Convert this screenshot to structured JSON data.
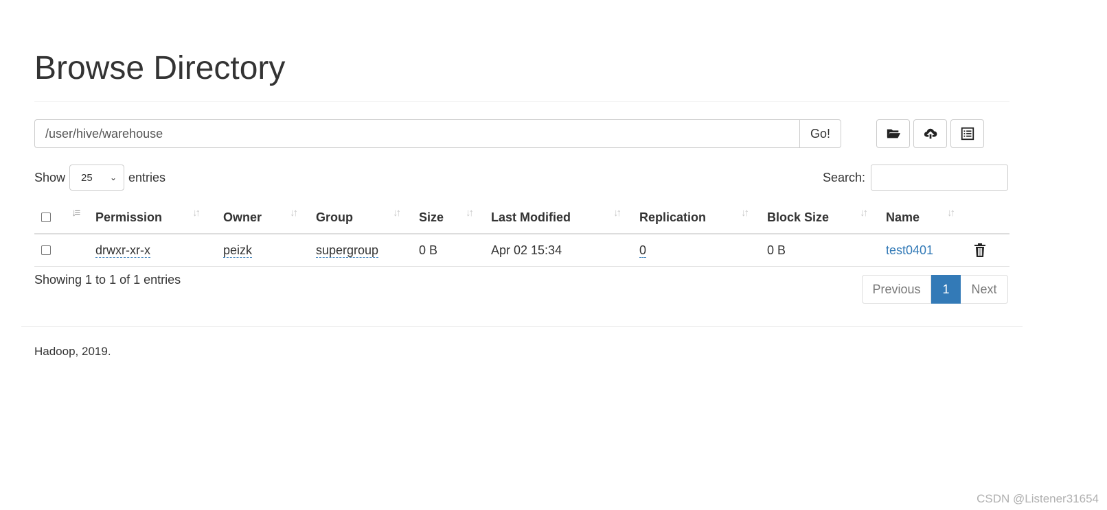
{
  "page": {
    "title": "Browse Directory",
    "path_value": "/user/hive/warehouse",
    "go_label": "Go!"
  },
  "toolbar": {
    "icons": [
      "folder-open-icon",
      "cloud-upload-icon",
      "list-alt-icon"
    ]
  },
  "entries": {
    "show_label": "Show",
    "selected": "25",
    "suffix": "entries"
  },
  "search": {
    "label": "Search:",
    "value": ""
  },
  "table": {
    "headers": {
      "permission": "Permission",
      "owner": "Owner",
      "group": "Group",
      "size": "Size",
      "last_modified": "Last Modified",
      "replication": "Replication",
      "block_size": "Block Size",
      "name": "Name"
    },
    "rows": [
      {
        "permission": "drwxr-xr-x",
        "owner": "peizk",
        "group": "supergroup",
        "size": "0 B",
        "last_modified": "Apr 02 15:34",
        "replication": "0",
        "block_size": "0 B",
        "name": "test0401"
      }
    ]
  },
  "info": "Showing 1 to 1 of 1 entries",
  "pagination": {
    "previous": "Previous",
    "current": "1",
    "next": "Next"
  },
  "footer": "Hadoop, 2019.",
  "watermark": "CSDN @Listener31654",
  "colors": {
    "link": "#337ab7",
    "active_page": "#337ab7",
    "border": "#dddddd"
  }
}
